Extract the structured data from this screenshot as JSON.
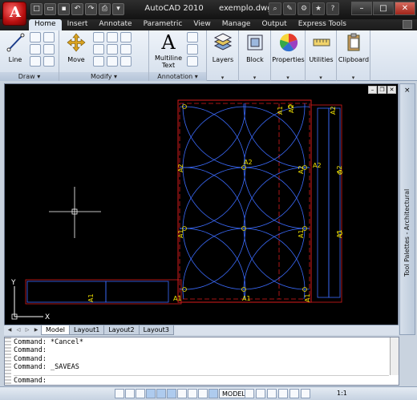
{
  "window": {
    "app_name": "AutoCAD 2010",
    "file_name": "exemplo.dwg"
  },
  "ribbon": {
    "tabs": [
      "Home",
      "Insert",
      "Annotate",
      "Parametric",
      "View",
      "Manage",
      "Output",
      "Express Tools"
    ],
    "active_tab": "Home",
    "panels": {
      "draw": {
        "title": "Draw",
        "line": "Line"
      },
      "modify": {
        "title": "Modify",
        "move": "Move"
      },
      "annotation": {
        "title": "Annotation",
        "multiline": "Multiline",
        "text": "Text"
      },
      "layers": "Layers",
      "block": "Block",
      "properties": "Properties",
      "utilities": "Utilities",
      "clipboard": "Clipboard"
    }
  },
  "drawing_labels": {
    "a_left": "A",
    "a1": "A1",
    "a2": "A2",
    "ucs_x": "X",
    "ucs_y": "Y"
  },
  "layout_tabs": [
    "Model",
    "Layout1",
    "Layout2",
    "Layout3"
  ],
  "tool_palette": {
    "title": "Tool Palettes - Architectural"
  },
  "command_line": {
    "history": [
      "Command: *Cancel*",
      "Command:",
      "Command:",
      "Command: _SAVEAS"
    ],
    "prompt": "Command:"
  },
  "status_bar": {
    "model_label": "MODEL",
    "scale": "1:1"
  },
  "colors": {
    "accent_red": "#b81010",
    "canvas_bg": "#000000",
    "geometry_blue": "#3c6cff",
    "geometry_red": "#d81c1c",
    "label_yellow": "#f0e000"
  }
}
